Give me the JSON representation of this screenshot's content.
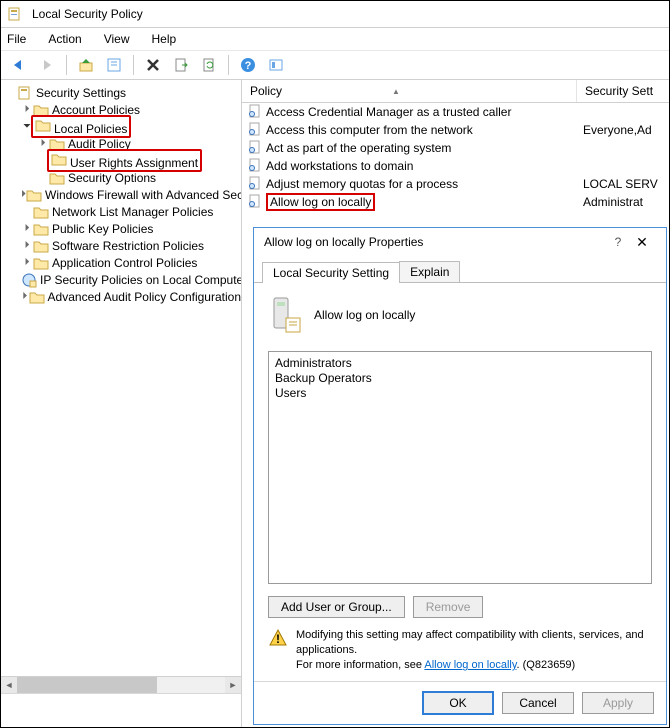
{
  "window": {
    "title": "Local Security Policy"
  },
  "menubar": [
    "File",
    "Action",
    "View",
    "Help"
  ],
  "tree": {
    "root": "Security Settings",
    "items": [
      {
        "label": "Account Policies",
        "chev": ">",
        "indent": 1
      },
      {
        "label": "Local Policies",
        "chev": "v",
        "indent": 1,
        "highlight": true
      },
      {
        "label": "Audit Policy",
        "chev": ">",
        "indent": 2
      },
      {
        "label": "User Rights Assignment",
        "chev": "",
        "indent": 2,
        "highlight": true
      },
      {
        "label": "Security Options",
        "chev": "",
        "indent": 2
      },
      {
        "label": "Windows Firewall with Advanced Secu",
        "chev": ">",
        "indent": 1
      },
      {
        "label": "Network List Manager Policies",
        "chev": "",
        "indent": 1
      },
      {
        "label": "Public Key Policies",
        "chev": ">",
        "indent": 1
      },
      {
        "label": "Software Restriction Policies",
        "chev": ">",
        "indent": 1
      },
      {
        "label": "Application Control Policies",
        "chev": ">",
        "indent": 1
      },
      {
        "label": "IP Security Policies on Local Compute",
        "chev": "",
        "indent": 1,
        "icon": "ipsec"
      },
      {
        "label": "Advanced Audit Policy Configuration",
        "chev": ">",
        "indent": 1
      }
    ]
  },
  "list": {
    "columns": {
      "policy": "Policy",
      "security": "Security Sett"
    },
    "rows": [
      {
        "label": "Access Credential Manager as a trusted caller",
        "value": ""
      },
      {
        "label": "Access this computer from the network",
        "value": "Everyone,Ad"
      },
      {
        "label": "Act as part of the operating system",
        "value": ""
      },
      {
        "label": "Add workstations to domain",
        "value": ""
      },
      {
        "label": "Adjust memory quotas for a process",
        "value": "LOCAL SERV"
      },
      {
        "label": "Allow log on locally",
        "value": "Administrat",
        "highlight": true
      }
    ]
  },
  "dialog": {
    "title": "Allow log on locally Properties",
    "tabs": {
      "active": "Local Security Setting",
      "inactive": "Explain"
    },
    "policy_name": "Allow log on locally",
    "members": [
      "Administrators",
      "Backup Operators",
      "Users"
    ],
    "add_btn": "Add User or Group...",
    "remove_btn": "Remove",
    "warn_line1": "Modifying this setting may affect compatibility with clients, services, and applications.",
    "warn_line2a": "For more information, see ",
    "warn_link": "Allow log on locally",
    "warn_line2b": ". (Q823659)",
    "ok": "OK",
    "cancel": "Cancel",
    "apply": "Apply"
  }
}
